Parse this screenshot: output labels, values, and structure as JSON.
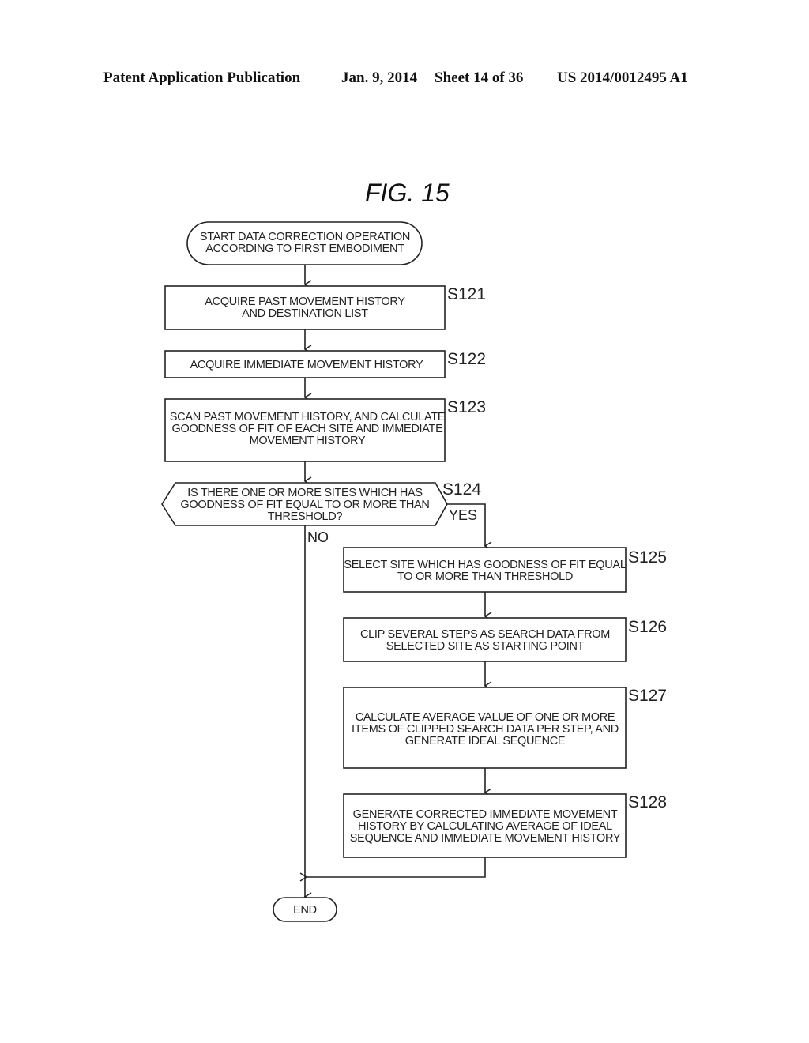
{
  "header": {
    "publication": "Patent Application Publication",
    "date": "Jan. 9, 2014",
    "sheet": "Sheet 14 of 36",
    "number": "US 2014/0012495 A1"
  },
  "figure": {
    "title": "FIG. 15"
  },
  "flowchart": {
    "start": {
      "lines": [
        "START DATA CORRECTION OPERATION",
        "ACCORDING TO FIRST EMBODIMENT"
      ]
    },
    "steps": [
      {
        "id": "S121",
        "lines": [
          "ACQUIRE PAST MOVEMENT HISTORY",
          "AND DESTINATION LIST"
        ]
      },
      {
        "id": "S122",
        "lines": [
          "ACQUIRE IMMEDIATE MOVEMENT HISTORY"
        ]
      },
      {
        "id": "S123",
        "lines": [
          "SCAN PAST MOVEMENT HISTORY, AND CALCULATE",
          "GOODNESS OF FIT OF EACH SITE AND IMMEDIATE",
          "MOVEMENT HISTORY"
        ]
      },
      {
        "id": "S124",
        "type": "decision",
        "lines": [
          "IS THERE ONE OR MORE SITES WHICH HAS",
          "GOODNESS OF FIT EQUAL TO OR MORE THAN",
          "THRESHOLD?"
        ]
      },
      {
        "id": "S125",
        "lines": [
          "SELECT SITE WHICH HAS GOODNESS OF FIT EQUAL",
          "TO OR MORE THAN THRESHOLD"
        ]
      },
      {
        "id": "S126",
        "lines": [
          "CLIP SEVERAL STEPS AS SEARCH DATA FROM",
          "SELECTED SITE AS STARTING POINT"
        ]
      },
      {
        "id": "S127",
        "lines": [
          "CALCULATE AVERAGE VALUE OF ONE OR MORE",
          "ITEMS OF CLIPPED SEARCH DATA PER STEP, AND",
          "GENERATE IDEAL SEQUENCE"
        ]
      },
      {
        "id": "S128",
        "lines": [
          "GENERATE CORRECTED IMMEDIATE MOVEMENT",
          "HISTORY BY CALCULATING AVERAGE OF IDEAL",
          "SEQUENCE AND IMMEDIATE MOVEMENT HISTORY"
        ]
      }
    ],
    "branches": {
      "yes": "YES",
      "no": "NO"
    },
    "end": {
      "label": "END"
    }
  }
}
